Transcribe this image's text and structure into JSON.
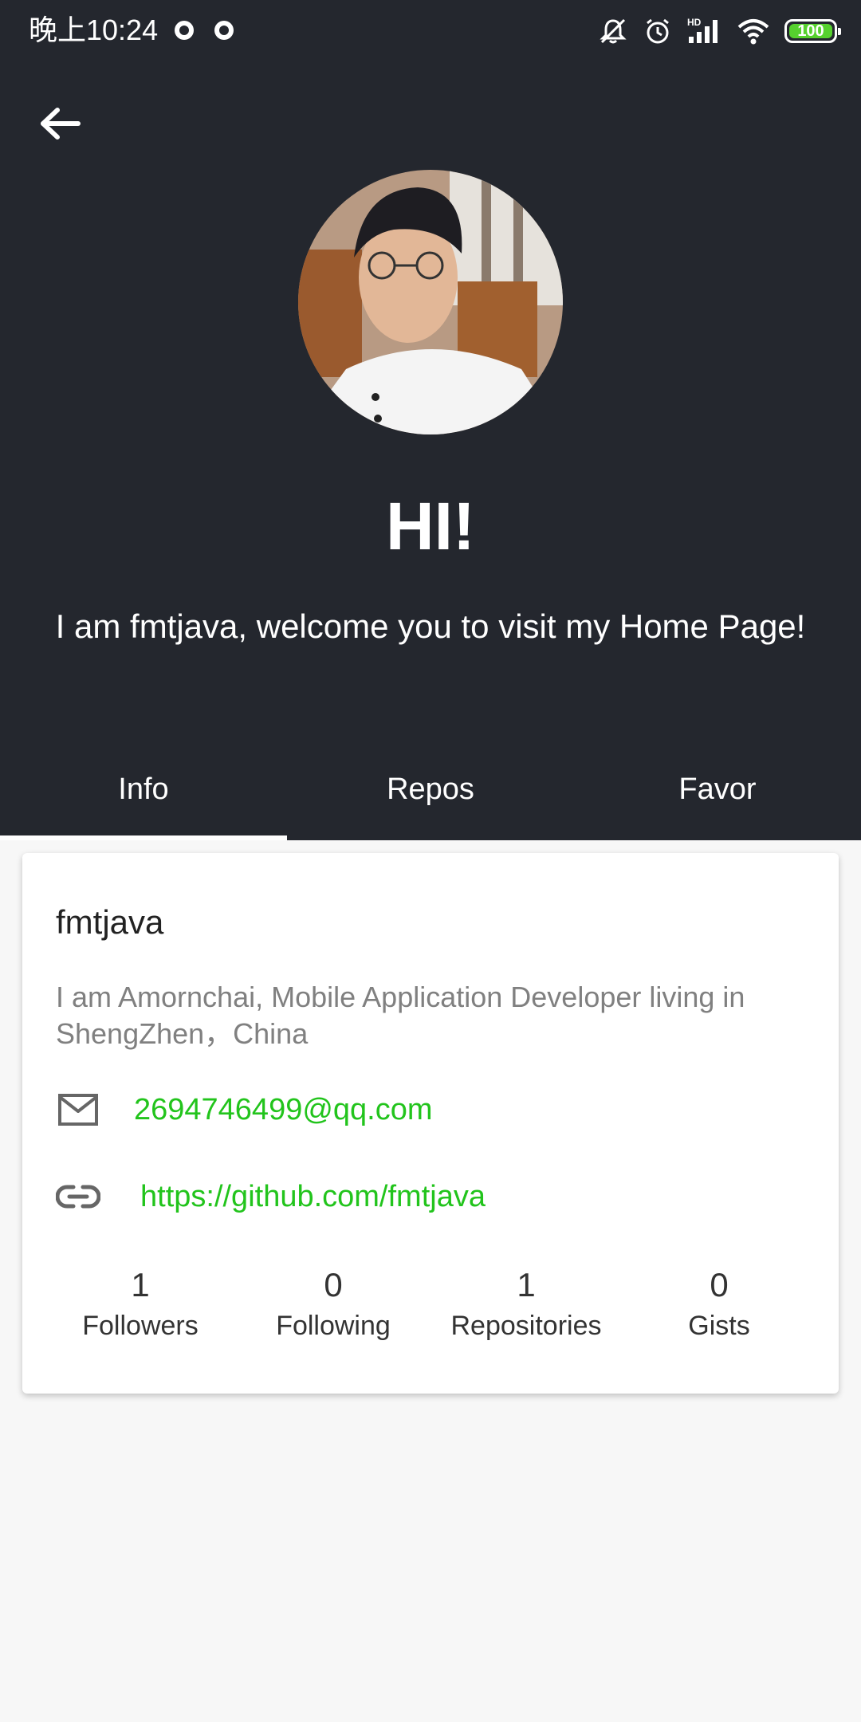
{
  "status_bar": {
    "time": "晚上10:24",
    "battery": "100"
  },
  "header": {
    "title": "HI!",
    "welcome": "I am fmtjava, welcome you to visit my Home Page!"
  },
  "tabs": [
    {
      "label": "Info",
      "selected": true
    },
    {
      "label": "Repos",
      "selected": false
    },
    {
      "label": "Favor",
      "selected": false
    }
  ],
  "profile": {
    "username": "fmtjava",
    "bio": "I am Amornchai, Mobile Application Developer living in ShengZhen，China",
    "email": "2694746499@qq.com",
    "link": "https://github.com/fmtjava"
  },
  "stats": [
    {
      "value": "1",
      "label": "Followers"
    },
    {
      "value": "0",
      "label": "Following"
    },
    {
      "value": "1",
      "label": "Repositories"
    },
    {
      "value": "0",
      "label": "Gists"
    }
  ],
  "colors": {
    "header_bg": "#24272e",
    "link_green": "#22c41c",
    "page_bg": "#f7f7f7",
    "battery_green": "#56d12e"
  }
}
